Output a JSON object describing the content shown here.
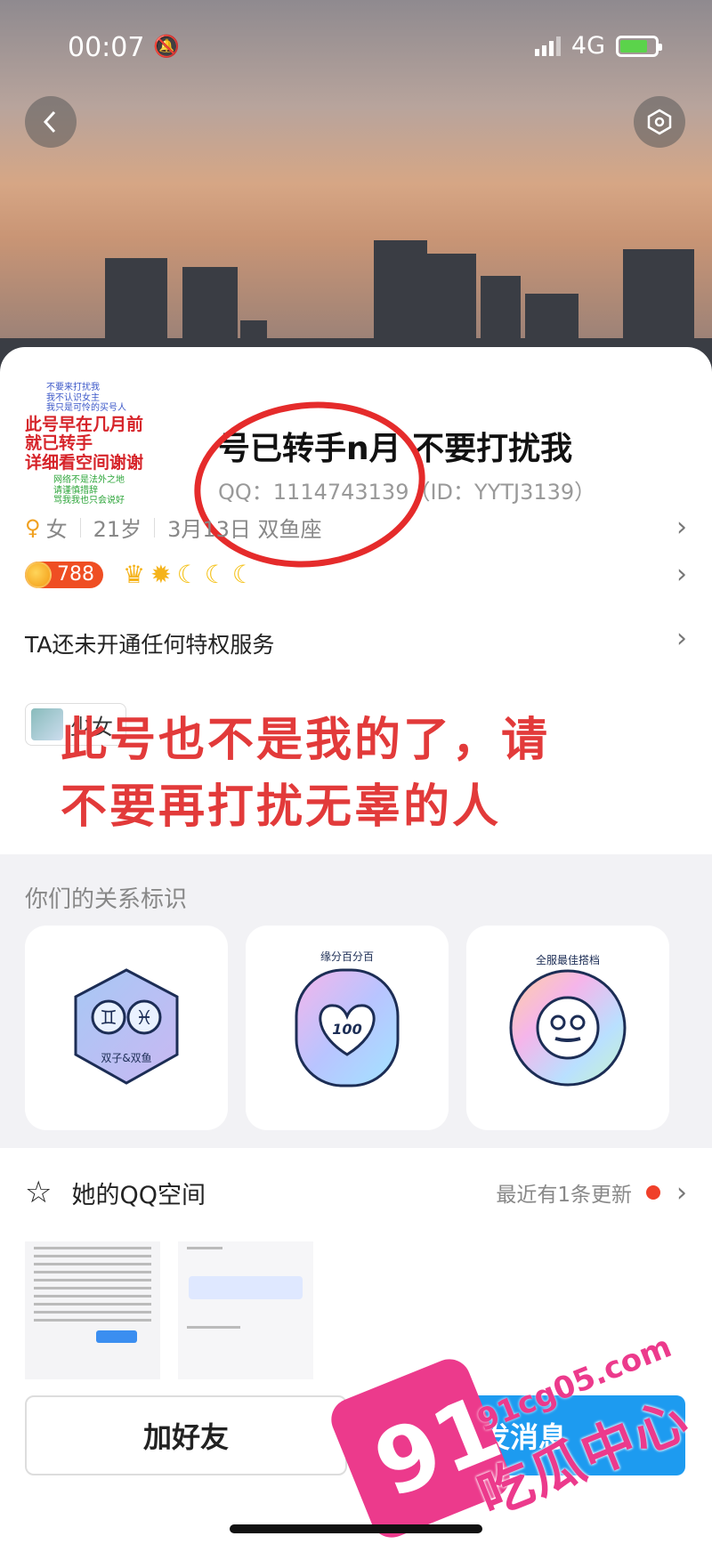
{
  "status_bar": {
    "time": "00:07",
    "network": "4G"
  },
  "header": {
    "back_icon": "chevron-left-icon",
    "menu_icon": "hexagon-icon"
  },
  "avatar_text": {
    "small_lines": [
      "不要来打扰我",
      "我不认识女主",
      "我只是可怜的买号人"
    ],
    "big_lines": [
      "此号早在几月前",
      "就已转手",
      "详细看空间谢谢"
    ],
    "green_lines": [
      "网络不是法外之地",
      "请谨慎措辞",
      "骂我我也只会说好"
    ]
  },
  "profile": {
    "nickname": "号已转手n月 不要打扰我",
    "qq_id_text": "QQ：1114743139（ID：YYTJ3139）",
    "gender": "女",
    "age": "21岁",
    "birthday": "3月13日 双鱼座",
    "coins": "788",
    "privilege_text": "TA还未开通任何特权服务",
    "tag_label": "少女"
  },
  "overlay_note": [
    "此号也不是我的了，请",
    "不要再打扰无辜的人"
  ],
  "relation": {
    "title": "你们的关系标识",
    "cards": [
      {
        "label": "双子&双鱼",
        "icon": "gemini-pisces-icon"
      },
      {
        "label": "缘分百分百",
        "icon": "heart-100-icon"
      },
      {
        "label": "全服最佳搭档",
        "icon": "smiley-badge-icon"
      }
    ]
  },
  "qzone": {
    "title": "她的QQ空间",
    "update_text": "最近有1条更新"
  },
  "actions": {
    "add_friend": "加好友",
    "send_message": "发消息"
  },
  "watermark": {
    "num": "91",
    "site": "91cg05.com",
    "name": "吃瓜中心"
  },
  "colors": {
    "accent_blue": "#1d9bf0",
    "red_note": "#e23a3a",
    "watermark_pink": "#ec3a8c"
  }
}
